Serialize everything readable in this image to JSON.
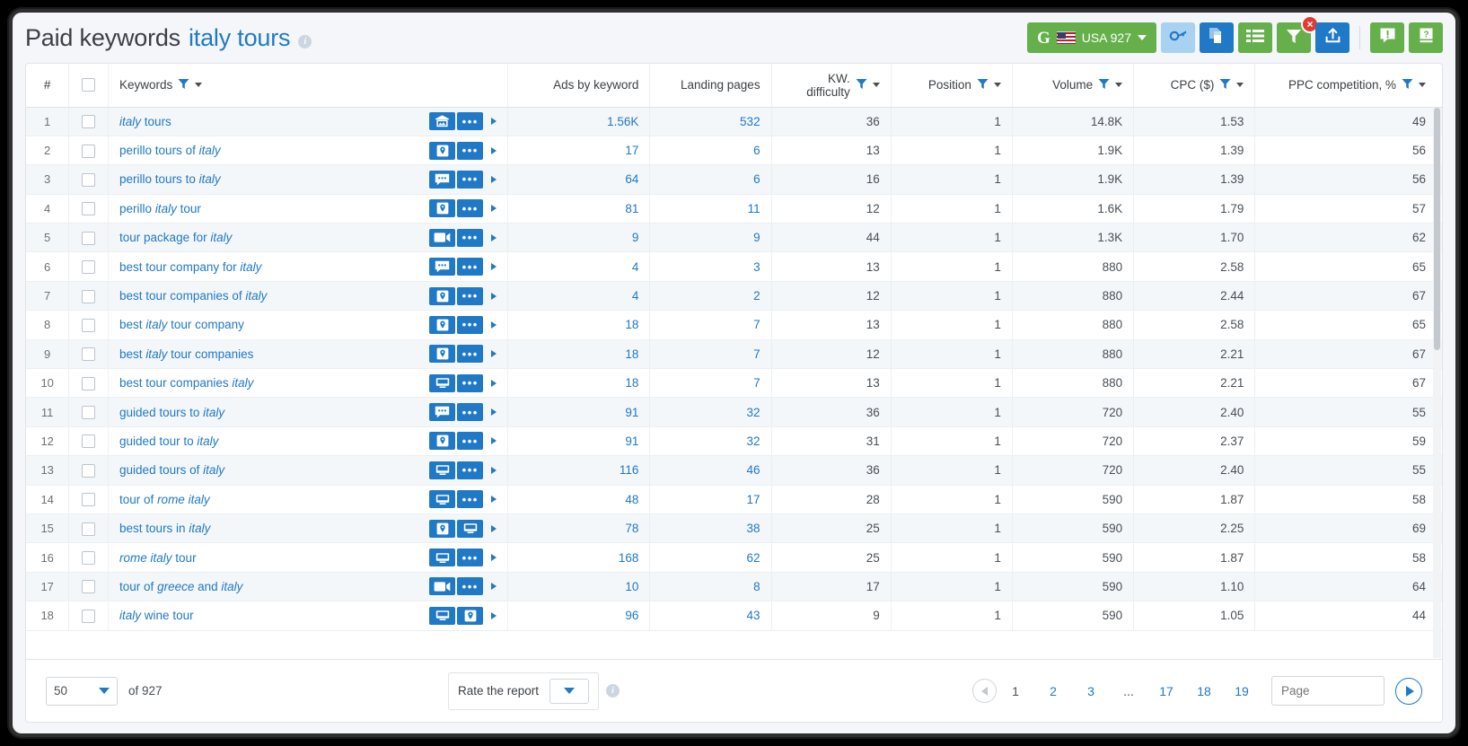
{
  "header": {
    "title_main": "Paid keywords",
    "title_keyword": "italy tours",
    "info_icon": "info-icon"
  },
  "toolbar": {
    "geo_button": {
      "engine": "G",
      "flag": "usa-flag-icon",
      "label": "USA 927",
      "caret": "chevron-down-icon"
    },
    "buttons": [
      {
        "name": "key-icon",
        "style": "light-blue"
      },
      {
        "name": "copy-pages-icon",
        "style": "blue"
      },
      {
        "name": "list-columns-icon",
        "style": "green"
      },
      {
        "name": "filter-icon",
        "style": "green",
        "badge": "×"
      },
      {
        "name": "export-upload-icon",
        "style": "blue"
      },
      {
        "name": "feedback-bubble-icon",
        "style": "green"
      },
      {
        "name": "help-manual-icon",
        "style": "green"
      }
    ]
  },
  "table": {
    "columns": [
      {
        "key": "index",
        "label": "#",
        "align": "center",
        "filter": false,
        "sort": false
      },
      {
        "key": "check",
        "label": "",
        "align": "center",
        "filter": false,
        "sort": false
      },
      {
        "key": "keyword",
        "label": "Keywords",
        "align": "left",
        "filter": true,
        "sort": true
      },
      {
        "key": "ads",
        "label": "Ads by keyword",
        "align": "right",
        "filter": false,
        "sort": false
      },
      {
        "key": "landing",
        "label": "Landing pages",
        "align": "right",
        "filter": false,
        "sort": false
      },
      {
        "key": "kwdiff",
        "label": "KW. difficulty",
        "align": "right",
        "filter": true,
        "sort": true
      },
      {
        "key": "position",
        "label": "Position",
        "align": "right",
        "filter": true,
        "sort": true
      },
      {
        "key": "volume",
        "label": "Volume",
        "align": "right",
        "filter": true,
        "sort": true
      },
      {
        "key": "cpc",
        "label": "CPC ($)",
        "align": "right",
        "filter": true,
        "sort": true
      },
      {
        "key": "ppc",
        "label": "PPC competition, %",
        "align": "right",
        "filter": true,
        "sort": true
      }
    ],
    "rows": [
      {
        "index": "1",
        "keyword_html": "<i>italy</i> tours",
        "icons": [
          "image-icon",
          "more-dots-icon"
        ],
        "ads": "1.56K",
        "landing": "532",
        "kwdiff": "36",
        "position": "1",
        "volume": "14.8K",
        "cpc": "1.53",
        "ppc": "49"
      },
      {
        "index": "2",
        "keyword_html": "perillo tours of <i>italy</i>",
        "icons": [
          "marker-icon",
          "more-dots-icon"
        ],
        "ads": "17",
        "landing": "6",
        "kwdiff": "13",
        "position": "1",
        "volume": "1.9K",
        "cpc": "1.39",
        "ppc": "56"
      },
      {
        "index": "3",
        "keyword_html": "perillo tours to <i>italy</i>",
        "icons": [
          "comment-icon",
          "more-dots-icon"
        ],
        "ads": "64",
        "landing": "6",
        "kwdiff": "16",
        "position": "1",
        "volume": "1.9K",
        "cpc": "1.39",
        "ppc": "56"
      },
      {
        "index": "4",
        "keyword_html": "perillo <i>italy</i> tour",
        "icons": [
          "marker-icon",
          "more-dots-icon"
        ],
        "ads": "81",
        "landing": "11",
        "kwdiff": "12",
        "position": "1",
        "volume": "1.6K",
        "cpc": "1.79",
        "ppc": "57"
      },
      {
        "index": "5",
        "keyword_html": "tour package for <i>italy</i>",
        "icons": [
          "video-icon",
          "more-dots-icon"
        ],
        "ads": "9",
        "landing": "9",
        "kwdiff": "44",
        "position": "1",
        "volume": "1.3K",
        "cpc": "1.70",
        "ppc": "62"
      },
      {
        "index": "6",
        "keyword_html": "best tour company for <i>italy</i>",
        "icons": [
          "comment-icon",
          "more-dots-icon"
        ],
        "ads": "4",
        "landing": "3",
        "kwdiff": "13",
        "position": "1",
        "volume": "880",
        "cpc": "2.58",
        "ppc": "65"
      },
      {
        "index": "7",
        "keyword_html": "best tour companies of <i>italy</i>",
        "icons": [
          "marker-icon",
          "more-dots-icon"
        ],
        "ads": "4",
        "landing": "2",
        "kwdiff": "12",
        "position": "1",
        "volume": "880",
        "cpc": "2.44",
        "ppc": "67"
      },
      {
        "index": "8",
        "keyword_html": "best <i>italy</i> tour company",
        "icons": [
          "marker-icon",
          "more-dots-icon"
        ],
        "ads": "18",
        "landing": "7",
        "kwdiff": "13",
        "position": "1",
        "volume": "880",
        "cpc": "2.58",
        "ppc": "65"
      },
      {
        "index": "9",
        "keyword_html": "best <i>italy</i> tour companies",
        "icons": [
          "marker-icon",
          "more-dots-icon"
        ],
        "ads": "18",
        "landing": "7",
        "kwdiff": "12",
        "position": "1",
        "volume": "880",
        "cpc": "2.21",
        "ppc": "67"
      },
      {
        "index": "10",
        "keyword_html": "best tour companies <i>italy</i>",
        "icons": [
          "desktop-icon",
          "more-dots-icon"
        ],
        "ads": "18",
        "landing": "7",
        "kwdiff": "13",
        "position": "1",
        "volume": "880",
        "cpc": "2.21",
        "ppc": "67"
      },
      {
        "index": "11",
        "keyword_html": "guided tours to <i>italy</i>",
        "icons": [
          "comment-icon",
          "more-dots-icon"
        ],
        "ads": "91",
        "landing": "32",
        "kwdiff": "36",
        "position": "1",
        "volume": "720",
        "cpc": "2.40",
        "ppc": "55"
      },
      {
        "index": "12",
        "keyword_html": "guided tour to <i>italy</i>",
        "icons": [
          "marker-icon",
          "more-dots-icon"
        ],
        "ads": "91",
        "landing": "32",
        "kwdiff": "31",
        "position": "1",
        "volume": "720",
        "cpc": "2.37",
        "ppc": "59"
      },
      {
        "index": "13",
        "keyword_html": "guided tours of <i>italy</i>",
        "icons": [
          "desktop-icon",
          "more-dots-icon"
        ],
        "ads": "116",
        "landing": "46",
        "kwdiff": "36",
        "position": "1",
        "volume": "720",
        "cpc": "2.40",
        "ppc": "55"
      },
      {
        "index": "14",
        "keyword_html": "tour of <i>rome italy</i>",
        "icons": [
          "desktop-icon",
          "more-dots-icon"
        ],
        "ads": "48",
        "landing": "17",
        "kwdiff": "28",
        "position": "1",
        "volume": "590",
        "cpc": "1.87",
        "ppc": "58"
      },
      {
        "index": "15",
        "keyword_html": "best tours in <i>italy</i>",
        "icons": [
          "marker-icon",
          "desktop-icon"
        ],
        "ads": "78",
        "landing": "38",
        "kwdiff": "25",
        "position": "1",
        "volume": "590",
        "cpc": "2.25",
        "ppc": "69"
      },
      {
        "index": "16",
        "keyword_html": "<i>rome italy</i> tour",
        "icons": [
          "desktop-icon",
          "more-dots-icon"
        ],
        "ads": "168",
        "landing": "62",
        "kwdiff": "25",
        "position": "1",
        "volume": "590",
        "cpc": "1.87",
        "ppc": "58"
      },
      {
        "index": "17",
        "keyword_html": "tour of <i>greece</i> and <i>italy</i>",
        "icons": [
          "video-icon",
          "more-dots-icon"
        ],
        "ads": "10",
        "landing": "8",
        "kwdiff": "17",
        "position": "1",
        "volume": "590",
        "cpc": "1.10",
        "ppc": "64"
      },
      {
        "index": "18",
        "keyword_html": "<i>italy</i> wine tour",
        "icons": [
          "desktop-icon",
          "marker-icon"
        ],
        "ads": "96",
        "landing": "43",
        "kwdiff": "9",
        "position": "1",
        "volume": "590",
        "cpc": "1.05",
        "ppc": "44"
      }
    ]
  },
  "footer": {
    "per_page": "50",
    "of_text": "of 927",
    "rate_label": "Rate the report",
    "rate_info_icon": "info-icon",
    "pagination": {
      "prev_icon": "chevron-left-icon",
      "next_icon": "chevron-right-icon",
      "pages": [
        "1",
        "2",
        "3",
        "...",
        "17",
        "18",
        "19"
      ],
      "current": "1",
      "page_input_placeholder": "Page",
      "page_input_value": ""
    }
  },
  "colors": {
    "accent_blue": "#2079c6",
    "green": "#65b04b",
    "light_blue": "#a9d2f2",
    "badge_red": "#e03c31",
    "text_dark": "#3c4044",
    "row_alt": "#f4f7fa"
  }
}
